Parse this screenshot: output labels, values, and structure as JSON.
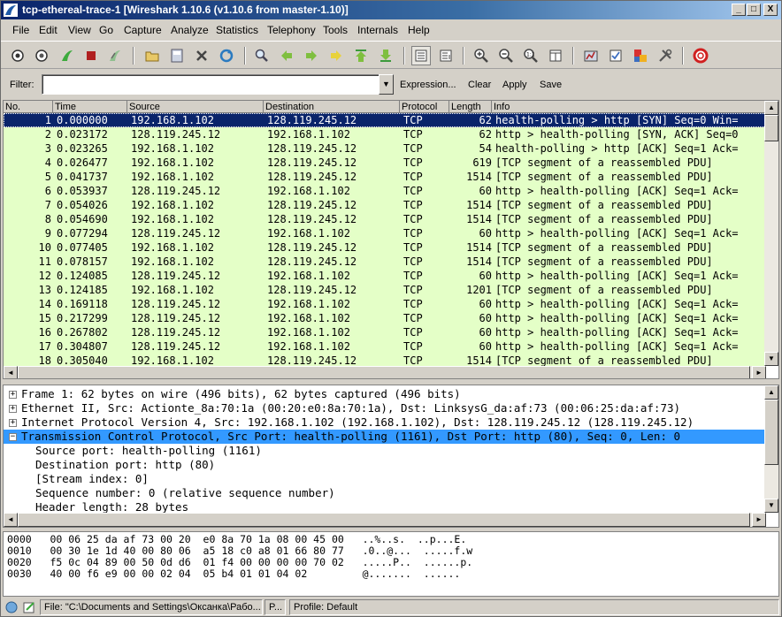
{
  "window": {
    "title": "tcp-ethereal-trace-1  [Wireshark 1.10.6  (v1.10.6 from master-1.10)]",
    "minimize_glyph": "_",
    "maximize_glyph": "□",
    "close_glyph": "X"
  },
  "menu": [
    "File",
    "Edit",
    "View",
    "Go",
    "Capture",
    "Analyze",
    "Statistics",
    "Telephony",
    "Tools",
    "Internals",
    "Help"
  ],
  "toolbar_icons": [
    "interface-list-icon",
    "capture-options-icon",
    "start-capture-icon",
    "stop-capture-icon",
    "restart-capture-icon",
    "open-file-icon",
    "save-file-icon",
    "close-file-icon",
    "reload-icon",
    "find-packet-icon",
    "go-back-icon",
    "go-forward-icon",
    "go-to-packet-icon",
    "go-first-icon",
    "go-last-icon",
    "colorize-icon",
    "auto-scroll-icon",
    "zoom-in-icon",
    "zoom-out-icon",
    "zoom-normal-icon",
    "resize-columns-icon",
    "capture-filters-icon",
    "display-filters-icon",
    "coloring-rules-icon",
    "preferences-icon",
    "help-icon"
  ],
  "filter": {
    "label": "Filter:",
    "value": "",
    "expression": "Expression...",
    "clear": "Clear",
    "apply": "Apply",
    "save": "Save"
  },
  "packet_list": {
    "columns": [
      "No.",
      "Time",
      "Source",
      "Destination",
      "Protocol",
      "Length",
      "Info"
    ],
    "rows": [
      {
        "no": "1",
        "time": "0.000000",
        "src": "192.168.1.102",
        "dst": "128.119.245.12",
        "proto": "TCP",
        "len": "62",
        "info": "health-polling > http [SYN] Seq=0 Win="
      },
      {
        "no": "2",
        "time": "0.023172",
        "src": "128.119.245.12",
        "dst": "192.168.1.102",
        "proto": "TCP",
        "len": "62",
        "info": "http > health-polling [SYN, ACK] Seq=0"
      },
      {
        "no": "3",
        "time": "0.023265",
        "src": "192.168.1.102",
        "dst": "128.119.245.12",
        "proto": "TCP",
        "len": "54",
        "info": "health-polling > http [ACK] Seq=1 Ack="
      },
      {
        "no": "4",
        "time": "0.026477",
        "src": "192.168.1.102",
        "dst": "128.119.245.12",
        "proto": "TCP",
        "len": "619",
        "info": "[TCP segment of a reassembled PDU]"
      },
      {
        "no": "5",
        "time": "0.041737",
        "src": "192.168.1.102",
        "dst": "128.119.245.12",
        "proto": "TCP",
        "len": "1514",
        "info": "[TCP segment of a reassembled PDU]"
      },
      {
        "no": "6",
        "time": "0.053937",
        "src": "128.119.245.12",
        "dst": "192.168.1.102",
        "proto": "TCP",
        "len": "60",
        "info": "http > health-polling [ACK] Seq=1 Ack="
      },
      {
        "no": "7",
        "time": "0.054026",
        "src": "192.168.1.102",
        "dst": "128.119.245.12",
        "proto": "TCP",
        "len": "1514",
        "info": "[TCP segment of a reassembled PDU]"
      },
      {
        "no": "8",
        "time": "0.054690",
        "src": "192.168.1.102",
        "dst": "128.119.245.12",
        "proto": "TCP",
        "len": "1514",
        "info": "[TCP segment of a reassembled PDU]"
      },
      {
        "no": "9",
        "time": "0.077294",
        "src": "128.119.245.12",
        "dst": "192.168.1.102",
        "proto": "TCP",
        "len": "60",
        "info": "http > health-polling [ACK] Seq=1 Ack="
      },
      {
        "no": "10",
        "time": "0.077405",
        "src": "192.168.1.102",
        "dst": "128.119.245.12",
        "proto": "TCP",
        "len": "1514",
        "info": "[TCP segment of a reassembled PDU]"
      },
      {
        "no": "11",
        "time": "0.078157",
        "src": "192.168.1.102",
        "dst": "128.119.245.12",
        "proto": "TCP",
        "len": "1514",
        "info": "[TCP segment of a reassembled PDU]"
      },
      {
        "no": "12",
        "time": "0.124085",
        "src": "128.119.245.12",
        "dst": "192.168.1.102",
        "proto": "TCP",
        "len": "60",
        "info": "http > health-polling [ACK] Seq=1 Ack="
      },
      {
        "no": "13",
        "time": "0.124185",
        "src": "192.168.1.102",
        "dst": "128.119.245.12",
        "proto": "TCP",
        "len": "1201",
        "info": "[TCP segment of a reassembled PDU]"
      },
      {
        "no": "14",
        "time": "0.169118",
        "src": "128.119.245.12",
        "dst": "192.168.1.102",
        "proto": "TCP",
        "len": "60",
        "info": "http > health-polling [ACK] Seq=1 Ack="
      },
      {
        "no": "15",
        "time": "0.217299",
        "src": "128.119.245.12",
        "dst": "192.168.1.102",
        "proto": "TCP",
        "len": "60",
        "info": "http > health-polling [ACK] Seq=1 Ack="
      },
      {
        "no": "16",
        "time": "0.267802",
        "src": "128.119.245.12",
        "dst": "192.168.1.102",
        "proto": "TCP",
        "len": "60",
        "info": "http > health-polling [ACK] Seq=1 Ack="
      },
      {
        "no": "17",
        "time": "0.304807",
        "src": "128.119.245.12",
        "dst": "192.168.1.102",
        "proto": "TCP",
        "len": "60",
        "info": "http > health-polling [ACK] Seq=1 Ack="
      },
      {
        "no": "18",
        "time": "0.305040",
        "src": "192.168.1.102",
        "dst": "128.119.245.12",
        "proto": "TCP",
        "len": "1514",
        "info": "[TCP segment of a reassembled PDU]"
      }
    ]
  },
  "details": [
    {
      "text": "Frame 1: 62 bytes on wire (496 bits), 62 bytes captured (496 bits)",
      "expander": "+"
    },
    {
      "text": "Ethernet II, Src: Actionte_8a:70:1a (00:20:e0:8a:70:1a), Dst: LinksysG_da:af:73 (00:06:25:da:af:73)",
      "expander": "+"
    },
    {
      "text": "Internet Protocol Version 4, Src: 192.168.1.102 (192.168.1.102), Dst: 128.119.245.12 (128.119.245.12)",
      "expander": "+"
    },
    {
      "text": "Transmission Control Protocol, Src Port: health-polling (1161), Dst Port: http (80), Seq: 0, Len: 0",
      "expander": "−"
    },
    {
      "text": "Source port: health-polling (1161)"
    },
    {
      "text": "Destination port: http (80)"
    },
    {
      "text": "[Stream index: 0]"
    },
    {
      "text": "Sequence number: 0    (relative sequence number)"
    },
    {
      "text": "Header length: 28 bytes"
    }
  ],
  "bytes": [
    "0000   00 06 25 da af 73 00 20  e0 8a 70 1a 08 00 45 00   ..%..s.  ..p...E.",
    "0010   00 30 1e 1d 40 00 80 06  a5 18 c0 a8 01 66 80 77   .0..@...  .....f.w",
    "0020   f5 0c 04 89 00 50 0d d6  01 f4 00 00 00 00 70 02   .....P..  ......p.",
    "0030   40 00 f6 e9 00 00 02 04  05 b4 01 01 04 02         @.......  ......"
  ],
  "status": {
    "file": "File: \"C:\\Documents and Settings\\Оксанка\\Рабо...",
    "packets": "P...",
    "profile": "Profile: Default"
  },
  "colors": {
    "title_start": "#0a246a",
    "row_bg": "#e4ffc7",
    "selected_row": "#0a246a",
    "selected_detail": "#3399ff"
  }
}
